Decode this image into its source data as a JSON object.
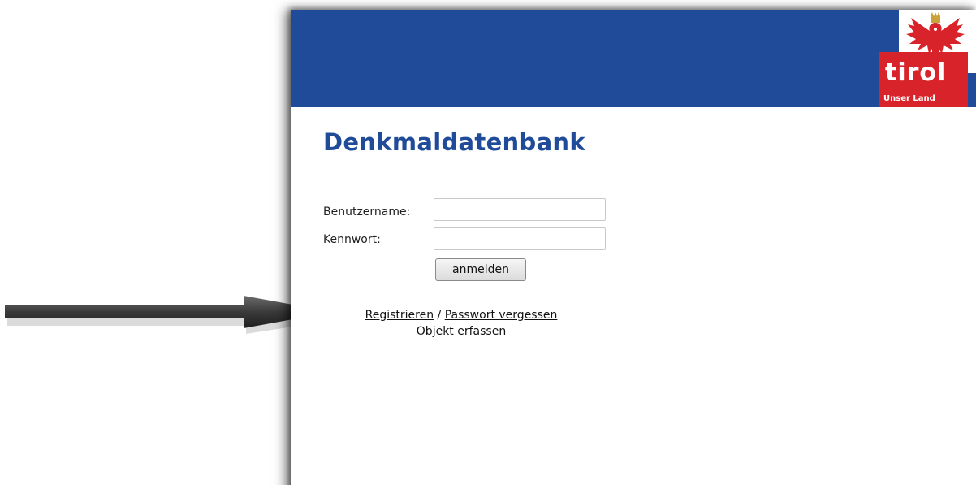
{
  "header": {
    "logo": {
      "word": "tirol",
      "subtitle": "Unser Land",
      "icon": "tyrol-eagle-icon"
    },
    "colors": {
      "header_bg": "#1f4b98",
      "logo_red": "#d8232a"
    }
  },
  "page": {
    "title": "Denkmaldatenbank"
  },
  "login_form": {
    "username_label": "Benutzername:",
    "username_value": "",
    "password_label": "Kennwort:",
    "password_value": "",
    "submit_label": "anmelden"
  },
  "links": {
    "register": "Registrieren",
    "separator": " / ",
    "forgot_password": "Passwort vergessen",
    "create_object": "Objekt erfassen"
  },
  "annotation": {
    "icon": "pointer-arrow-icon"
  }
}
